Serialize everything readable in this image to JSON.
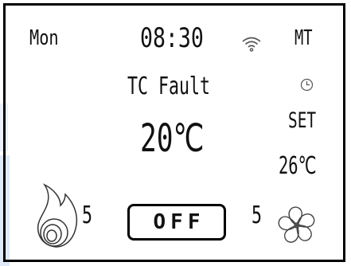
{
  "header": {
    "day": "Mon",
    "time": "08:30",
    "mode": "MT"
  },
  "status": {
    "message": "TC Fault"
  },
  "temperature": {
    "current": "20℃",
    "set_label": "SET",
    "set_value": "26℃"
  },
  "controls": {
    "heat_level": "5",
    "power_label": "OFF",
    "fan_level": "5"
  },
  "icons": {
    "wifi": "wifi-icon",
    "clock": "clock-icon",
    "heat": "flame-icon",
    "fan": "fan-icon"
  },
  "colors": {
    "foreground": "#111111",
    "background": "#ffffff",
    "edge_tint": "#dfe9f8"
  }
}
